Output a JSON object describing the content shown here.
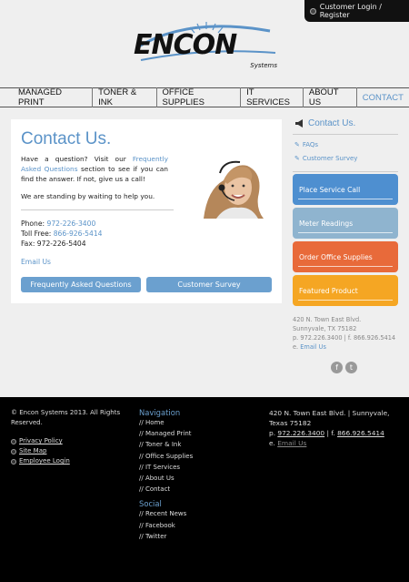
{
  "header": {
    "login_label": "Customer Login / Register",
    "logo_text": "ENCON",
    "logo_subtext": "Systems"
  },
  "nav": {
    "items": [
      {
        "label": "MANAGED PRINT"
      },
      {
        "label": "TONER & INK"
      },
      {
        "label": "OFFICE SUPPLIES"
      },
      {
        "label": "IT SERVICES"
      },
      {
        "label": "ABOUT US"
      },
      {
        "label": "CONTACT",
        "active": true
      }
    ]
  },
  "main": {
    "title": "Contact Us.",
    "intro_before": "Have a question? Visit our ",
    "intro_link": "Frequently Asked Questions",
    "intro_after": " section to see if you can find the answer. If not, give us a call!",
    "standing": "We are standing by waiting to help you.",
    "phone_label": "Phone: ",
    "phone": "972-226-3400",
    "tollfree_label": "Toll Free: ",
    "tollfree": "866-926-5414",
    "fax": "Fax: 972-226-5404",
    "email_link": "Email Us",
    "faq_button": "Frequently Asked Questions",
    "survey_button": "Customer Survey"
  },
  "sidebar": {
    "title": "Contact Us.",
    "links": [
      "FAQs",
      "Customer Survey"
    ],
    "tiles": [
      "Place Service Call",
      "Meter Readings",
      "Order Office Supplies",
      "Featured Product"
    ],
    "address_line1": "420 N. Town East Blvd.",
    "address_line2": "Sunnyvale, TX 75182",
    "phones": "p. 972.226.3400  |  f. 866.926.5414",
    "email_prefix": "e. ",
    "email_link": "Email Us",
    "social": [
      "f",
      "t"
    ]
  },
  "footer": {
    "copyright": "© Encon Systems 2013. All Rights Reserved.",
    "links": [
      "Privacy Policy",
      "Site Map",
      "Employee Login"
    ],
    "nav_heading": "Navigation",
    "nav_items": [
      "//  Home",
      "//  Managed Print",
      "//  Toner & Ink",
      "//  Office Supplies",
      "//  IT Services",
      "//  About Us",
      "//  Contact"
    ],
    "social_heading": "Social",
    "social_items": [
      "//  Recent News",
      "//  Facebook",
      "//  Twitter"
    ],
    "address": "420 N. Town East Blvd.  |  Sunnyvale, Texas 75182",
    "phone_prefix": "p. ",
    "phone": "972.226.3400",
    "fax_sep": "  |  f. ",
    "fax": "866.926.5414",
    "email_prefix": "e. ",
    "email_link": "Email Us"
  },
  "colors": {
    "accent": "#5b93c8",
    "tile_blue": "#4e8fd0",
    "tile_grey_blue": "#8fb4cf",
    "tile_orange": "#e86a3a",
    "tile_yellow": "#f5a623"
  },
  "icons": {
    "login": "globe-icon",
    "sidebar_title": "megaphone-icon",
    "sidebar_link": "link-icon",
    "social": [
      "facebook-icon",
      "twitter-icon"
    ]
  }
}
